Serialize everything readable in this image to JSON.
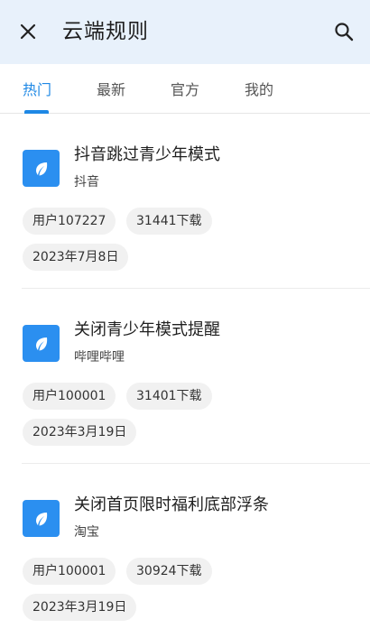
{
  "header": {
    "title": "云端规则"
  },
  "tabs": [
    {
      "label": "热门",
      "active": true
    },
    {
      "label": "最新",
      "active": false
    },
    {
      "label": "官方",
      "active": false
    },
    {
      "label": "我的",
      "active": false
    }
  ],
  "rules": [
    {
      "name": "抖音跳过青少年模式",
      "app": "抖音",
      "user": "用户107227",
      "downloads": "31441下载",
      "date": "2023年7月8日"
    },
    {
      "name": "关闭青少年模式提醒",
      "app": "哔哩哔哩",
      "user": "用户100001",
      "downloads": "31401下载",
      "date": "2023年3月19日"
    },
    {
      "name": "关闭首页限时福利底部浮条",
      "app": "淘宝",
      "user": "用户100001",
      "downloads": "30924下载",
      "date": "2023年3月19日"
    }
  ],
  "colors": {
    "accent": "#1e88e5",
    "header_bg": "#e8f1fb",
    "icon_bg": "#2b8ff0",
    "chip_bg": "#f1f1f1"
  },
  "icons": {
    "close": "close-icon",
    "search": "search-icon",
    "rule_app": "leaf-icon"
  }
}
